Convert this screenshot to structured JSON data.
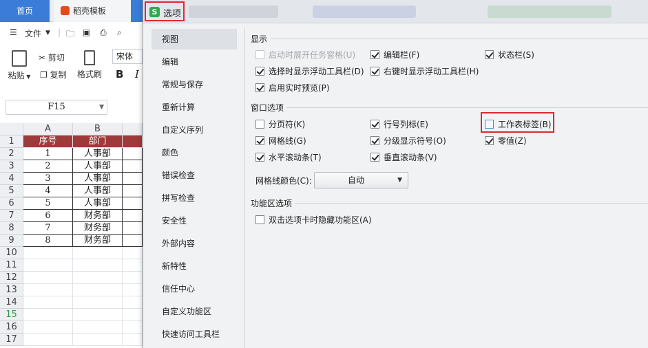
{
  "app": {
    "tabs": {
      "home": "首页",
      "template": "稻壳模板"
    },
    "toolbar": {
      "file_menu": "文件"
    },
    "ribbon": {
      "paste": "粘贴",
      "cut": "剪切",
      "copy": "复制",
      "format_painter": "格式刷",
      "font_name": "宋体",
      "bold": "B",
      "italic": "I"
    },
    "name_box": "F15",
    "sheet": {
      "columns": [
        "A",
        "B"
      ],
      "header_row": [
        "序号",
        "部门"
      ],
      "rows": [
        [
          "1",
          "人事部"
        ],
        [
          "2",
          "人事部"
        ],
        [
          "3",
          "人事部"
        ],
        [
          "4",
          "人事部"
        ],
        [
          "5",
          "人事部"
        ],
        [
          "6",
          "财务部"
        ],
        [
          "7",
          "财务部"
        ],
        [
          "8",
          "财务部"
        ]
      ],
      "row_numbers": [
        "1",
        "2",
        "3",
        "4",
        "5",
        "6",
        "7",
        "8",
        "9",
        "10",
        "11",
        "12",
        "13",
        "14",
        "15",
        "16",
        "17"
      ],
      "active_row": "15"
    }
  },
  "dialog": {
    "title": "选项",
    "nav_items": [
      "视图",
      "编辑",
      "常规与保存",
      "重新计算",
      "自定义序列",
      "颜色",
      "错误检查",
      "拼写检查",
      "安全性",
      "外部内容",
      "新特性",
      "信任中心",
      "自定义功能区",
      "快速访问工具栏"
    ],
    "selected_nav": "视图",
    "sections": {
      "display": {
        "title": "显示",
        "options": [
          {
            "label": "启动时展开任务窗格(U)",
            "checked": false,
            "disabled": true
          },
          {
            "label": "编辑栏(F)",
            "checked": true,
            "disabled": false
          },
          {
            "label": "状态栏(S)",
            "checked": true,
            "disabled": false
          },
          {
            "label": "选择时显示浮动工具栏(D)",
            "checked": true,
            "disabled": false
          },
          {
            "label": "右键时显示浮动工具栏(H)",
            "checked": true,
            "disabled": false
          },
          {
            "label": "启用实时预览(P)",
            "checked": true,
            "disabled": false
          }
        ]
      },
      "window": {
        "title": "窗口选项",
        "options": [
          {
            "label": "分页符(K)",
            "checked": false
          },
          {
            "label": "行号列标(E)",
            "checked": true
          },
          {
            "label": "工作表标签(B)",
            "checked": false
          },
          {
            "label": "网格线(G)",
            "checked": true
          },
          {
            "label": "分级显示符号(O)",
            "checked": true
          },
          {
            "label": "零值(Z)",
            "checked": true
          },
          {
            "label": "水平滚动条(T)",
            "checked": true
          },
          {
            "label": "垂直滚动条(V)",
            "checked": true
          }
        ],
        "gridline_color_label": "网格线颜色(C):",
        "gridline_color_value": "自动"
      },
      "ribbon": {
        "title": "功能区选项",
        "options": [
          {
            "label": "双击选项卡时隐藏功能区(A)",
            "checked": false
          }
        ]
      }
    },
    "colors": {
      "highlight": "#e0282e",
      "accent": "#3b7cd8",
      "header_fill": "#9e3a3a"
    }
  }
}
